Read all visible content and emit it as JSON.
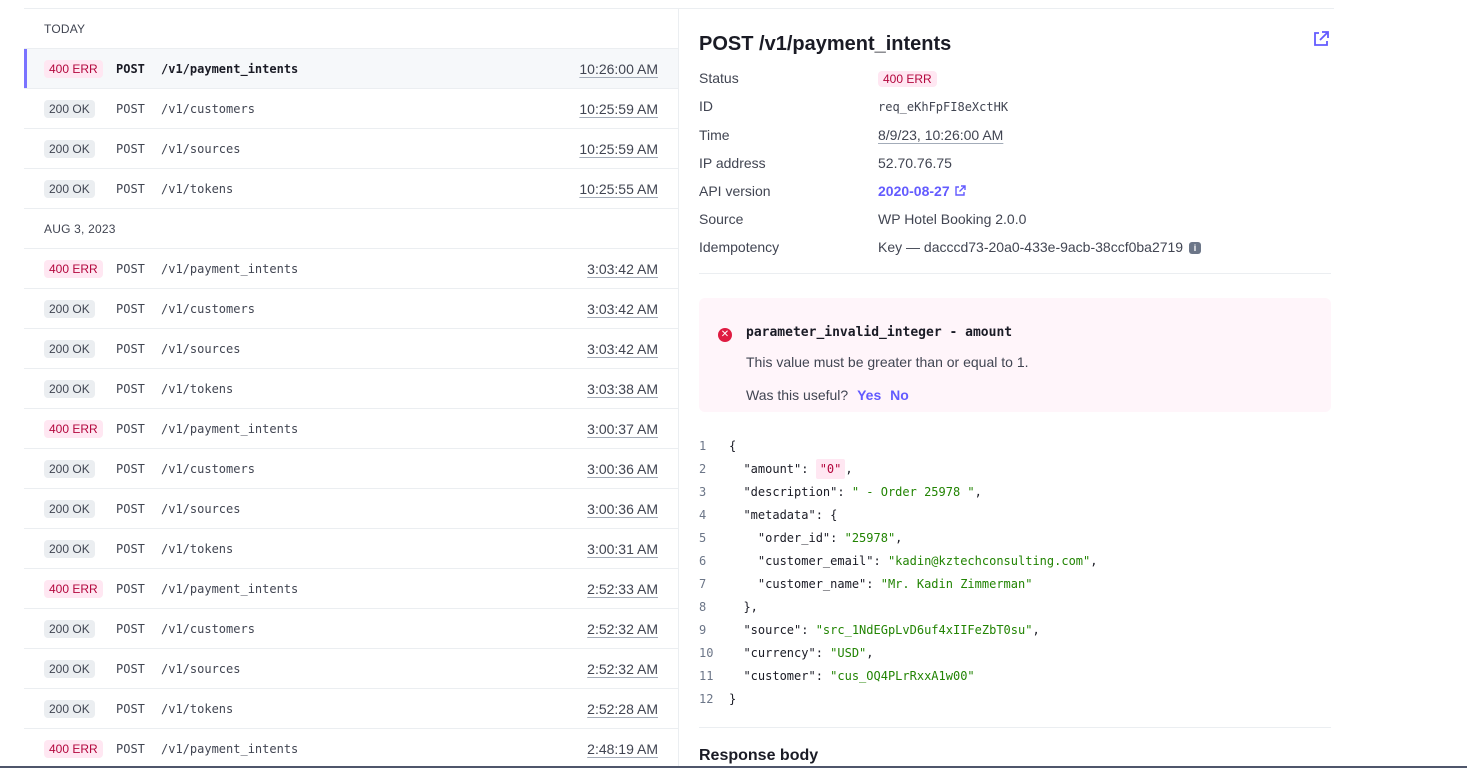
{
  "groups": [
    {
      "label": "TODAY",
      "rows": [
        {
          "status": "400 ERR",
          "kind": "err",
          "method": "POST",
          "path": "/v1/payment_intents",
          "time": "10:26:00 AM",
          "selected": true
        },
        {
          "status": "200 OK",
          "kind": "ok",
          "method": "POST",
          "path": "/v1/customers",
          "time": "10:25:59 AM"
        },
        {
          "status": "200 OK",
          "kind": "ok",
          "method": "POST",
          "path": "/v1/sources",
          "time": "10:25:59 AM"
        },
        {
          "status": "200 OK",
          "kind": "ok",
          "method": "POST",
          "path": "/v1/tokens",
          "time": "10:25:55 AM"
        }
      ]
    },
    {
      "label": "AUG 3, 2023",
      "rows": [
        {
          "status": "400 ERR",
          "kind": "err",
          "method": "POST",
          "path": "/v1/payment_intents",
          "time": "3:03:42 AM"
        },
        {
          "status": "200 OK",
          "kind": "ok",
          "method": "POST",
          "path": "/v1/customers",
          "time": "3:03:42 AM"
        },
        {
          "status": "200 OK",
          "kind": "ok",
          "method": "POST",
          "path": "/v1/sources",
          "time": "3:03:42 AM"
        },
        {
          "status": "200 OK",
          "kind": "ok",
          "method": "POST",
          "path": "/v1/tokens",
          "time": "3:03:38 AM"
        },
        {
          "status": "400 ERR",
          "kind": "err",
          "method": "POST",
          "path": "/v1/payment_intents",
          "time": "3:00:37 AM"
        },
        {
          "status": "200 OK",
          "kind": "ok",
          "method": "POST",
          "path": "/v1/customers",
          "time": "3:00:36 AM"
        },
        {
          "status": "200 OK",
          "kind": "ok",
          "method": "POST",
          "path": "/v1/sources",
          "time": "3:00:36 AM"
        },
        {
          "status": "200 OK",
          "kind": "ok",
          "method": "POST",
          "path": "/v1/tokens",
          "time": "3:00:31 AM"
        },
        {
          "status": "400 ERR",
          "kind": "err",
          "method": "POST",
          "path": "/v1/payment_intents",
          "time": "2:52:33 AM"
        },
        {
          "status": "200 OK",
          "kind": "ok",
          "method": "POST",
          "path": "/v1/customers",
          "time": "2:52:32 AM"
        },
        {
          "status": "200 OK",
          "kind": "ok",
          "method": "POST",
          "path": "/v1/sources",
          "time": "2:52:32 AM"
        },
        {
          "status": "200 OK",
          "kind": "ok",
          "method": "POST",
          "path": "/v1/tokens",
          "time": "2:52:28 AM"
        },
        {
          "status": "400 ERR",
          "kind": "err",
          "method": "POST",
          "path": "/v1/payment_intents",
          "time": "2:48:19 AM"
        }
      ]
    }
  ],
  "detail": {
    "title": "POST /v1/payment_intents",
    "open_icon": "external-link-icon",
    "fields": {
      "status_label": "Status",
      "status_value": "400 ERR",
      "id_label": "ID",
      "id_value": "req_eKhFpFI8eXctHK",
      "time_label": "Time",
      "time_value": "8/9/23, 10:26:00 AM",
      "ip_label": "IP address",
      "ip_value": "52.70.76.75",
      "api_label": "API version",
      "api_value": "2020-08-27",
      "source_label": "Source",
      "source_value": "WP Hotel Booking 2.0.0",
      "idem_label": "Idempotency",
      "idem_value": "Key — dacccd73-20a0-433e-9acb-38ccf0ba2719"
    },
    "error": {
      "code": "parameter_invalid_integer - amount",
      "message": "This value must be greater than or equal to 1.",
      "useful_prompt": "Was this useful?",
      "yes": "Yes",
      "no": "No"
    },
    "code_lines": [
      [
        {
          "t": "{",
          "c": "p"
        }
      ],
      [
        {
          "t": "  \"amount\": ",
          "c": "p"
        },
        {
          "t": "\"0\"",
          "c": "hl"
        },
        {
          "t": ",",
          "c": "p"
        }
      ],
      [
        {
          "t": "  \"description\": ",
          "c": "p"
        },
        {
          "t": "\" - Order 25978 \"",
          "c": "s"
        },
        {
          "t": ",",
          "c": "p"
        }
      ],
      [
        {
          "t": "  \"metadata\": {",
          "c": "p"
        }
      ],
      [
        {
          "t": "    \"order_id\": ",
          "c": "p"
        },
        {
          "t": "\"25978\"",
          "c": "s"
        },
        {
          "t": ",",
          "c": "p"
        }
      ],
      [
        {
          "t": "    \"customer_email\": ",
          "c": "p"
        },
        {
          "t": "\"kadin@kztechconsulting.com\"",
          "c": "s"
        },
        {
          "t": ",",
          "c": "p"
        }
      ],
      [
        {
          "t": "    \"customer_name\": ",
          "c": "p"
        },
        {
          "t": "\"Mr. Kadin Zimmerman\"",
          "c": "s"
        }
      ],
      [
        {
          "t": "  },",
          "c": "p"
        }
      ],
      [
        {
          "t": "  \"source\": ",
          "c": "p"
        },
        {
          "t": "\"src_1NdEGpLvD6uf4xIIFeZbT0su\"",
          "c": "s"
        },
        {
          "t": ",",
          "c": "p"
        }
      ],
      [
        {
          "t": "  \"currency\": ",
          "c": "p"
        },
        {
          "t": "\"USD\"",
          "c": "s"
        },
        {
          "t": ",",
          "c": "p"
        }
      ],
      [
        {
          "t": "  \"customer\": ",
          "c": "p"
        },
        {
          "t": "\"cus_OQ4PLrRxxA1w00\"",
          "c": "s"
        }
      ],
      [
        {
          "t": "}",
          "c": "p"
        }
      ]
    ],
    "response_title": "Response body"
  }
}
